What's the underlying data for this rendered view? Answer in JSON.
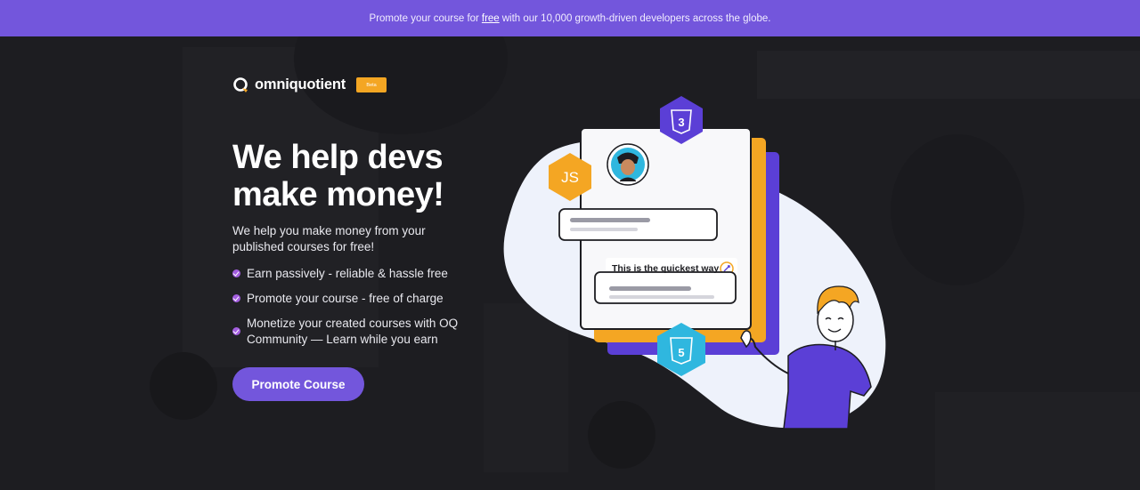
{
  "banner": {
    "text_before": "Promote your course for",
    "link_text": "free",
    "text_after": "with our 10,000 growth-driven developers across the globe."
  },
  "brand": {
    "name": "omniquotient",
    "badge": "Beta",
    "icon": "omniquotient-logo-icon"
  },
  "hero": {
    "title": "We help devs make money!",
    "subtitle": "We help you make money from your published courses for free!",
    "features": [
      "Earn passively - reliable & hassle free",
      "Promote your course - free of charge",
      "Monetize your created courses with OQ Community — Learn while you earn"
    ],
    "cta_label": "Promote Course"
  },
  "illustration": {
    "quick_label": "This is the quickest way",
    "js_badge": "JS",
    "css_badge": "3",
    "html_badge": "5"
  },
  "colors": {
    "banner": "#7356dc",
    "background": "#1d1d21",
    "accent": "#7356dc",
    "orange": "#f4a623",
    "check": "#a35ddf",
    "cyan": "#2fb7df"
  }
}
